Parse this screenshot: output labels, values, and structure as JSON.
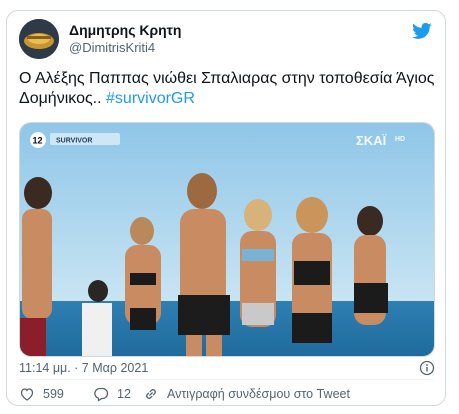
{
  "tweet": {
    "author": {
      "display_name": "Δημητρης Κρητη",
      "handle": "@DimitrisKriti4",
      "avatar_icon": "avatar-image"
    },
    "brand_icon": "twitter-bird-icon",
    "brand_color": "#1d9bf0",
    "text_plain": "Ο Αλέξης Παππας νιώθει Σπαλιαρας στην τοποθεσία Άγιος Δομήνικος.. ",
    "hashtag": "#survivorGR",
    "media": {
      "channel_logo": "ΣΚΑΪ",
      "channel_suffix": "HD",
      "rating_badge": "12",
      "show_banner": "SURVIVOR"
    },
    "timestamp": "11:14 μμ. · 7 Μαρ 2021",
    "actions": {
      "likes_count": "599",
      "replies_count": "12",
      "copy_link_label": "Αντιγραφή συνδέσμου στο Tweet"
    }
  }
}
